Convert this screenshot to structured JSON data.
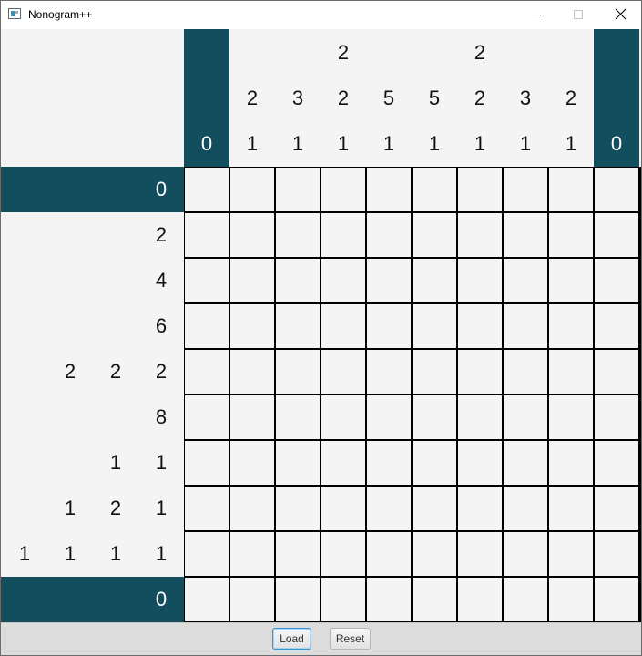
{
  "window": {
    "title": "Nonogram++",
    "icon": "app-window-icon",
    "controls": [
      "minimize-icon",
      "maximize-icon",
      "close-icon"
    ]
  },
  "colors": {
    "clue_zero_background": "#124e5e",
    "clue_background": "#f4f4f4",
    "cell_background": "#f4f4f4",
    "grid_line": "#000000"
  },
  "puzzle": {
    "rows": 10,
    "cols": 10,
    "column_clues": [
      [
        "0"
      ],
      [
        "2",
        "1"
      ],
      [
        "3",
        "1"
      ],
      [
        "2",
        "2",
        "1"
      ],
      [
        "5",
        "1"
      ],
      [
        "5",
        "1"
      ],
      [
        "2",
        "2",
        "1"
      ],
      [
        "3",
        "1"
      ],
      [
        "2",
        "1"
      ],
      [
        "0"
      ]
    ],
    "row_clues": [
      [
        "0"
      ],
      [
        "2"
      ],
      [
        "4"
      ],
      [
        "6"
      ],
      [
        "2",
        "2",
        "2"
      ],
      [
        "8"
      ],
      [
        "1",
        "1"
      ],
      [
        "1",
        "2",
        "1"
      ],
      [
        "1",
        "1",
        "1",
        "1"
      ],
      [
        "0"
      ]
    ]
  },
  "buttons": {
    "load_label": "Load",
    "reset_label": "Reset"
  }
}
